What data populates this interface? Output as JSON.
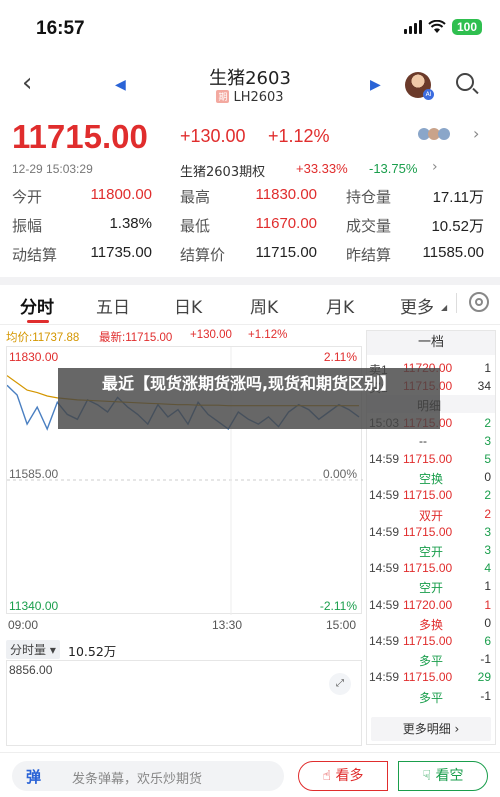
{
  "status": {
    "time": "16:57",
    "battery": "100"
  },
  "nav": {
    "title": "生猪2603",
    "tag": "期",
    "code": "LH2603"
  },
  "quote": {
    "price": "11715.00",
    "change_abs": "+130.00",
    "change_pct": "+1.12%",
    "time": "12-29 15:03:29",
    "option_name": "生猪2603期权",
    "option_up": "+33.33%",
    "option_down": "-13.75%"
  },
  "stats": [
    [
      {
        "label": "今开",
        "value": "11800.00",
        "color": "red"
      },
      {
        "label": "最高",
        "value": "11830.00",
        "color": "red"
      },
      {
        "label": "持仓量",
        "value": "17.11万",
        "color": "dark"
      }
    ],
    [
      {
        "label": "振幅",
        "value": "1.38%",
        "color": "dark"
      },
      {
        "label": "最低",
        "value": "11670.00",
        "color": "red"
      },
      {
        "label": "成交量",
        "value": "10.52万",
        "color": "dark"
      }
    ],
    [
      {
        "label": "动结算",
        "value": "11735.00",
        "color": "dark"
      },
      {
        "label": "结算价",
        "value": "11715.00",
        "color": "dark"
      },
      {
        "label": "昨结算",
        "value": "11585.00",
        "color": "dark"
      }
    ]
  ],
  "tabs": [
    "分时",
    "五日",
    "日K",
    "周K",
    "月K",
    "更多"
  ],
  "chart_header": {
    "avg": "均价:11737.88",
    "newest": "最新:11715.00",
    "abs": "+130.00",
    "pct": "+1.12%"
  },
  "chart_data": {
    "type": "line",
    "x_ticks": [
      "09:00",
      "13:30",
      "15:00"
    ],
    "y_left_ticks": [
      "11830.00",
      "11585.00",
      "11340.00"
    ],
    "y_right_ticks": [
      "2.11%",
      "0.00%",
      "-2.11%"
    ],
    "ylim": [
      11340,
      11830
    ],
    "series": [
      {
        "values": [
          11780,
          11760,
          11700,
          11735,
          11690,
          11745,
          11720,
          11710,
          11750,
          11740,
          11725,
          11755,
          11735,
          11720,
          11700,
          11740,
          11715,
          11730,
          11700,
          11745,
          11720,
          11705,
          11690,
          11725,
          11710,
          11700,
          11715,
          11695,
          11725,
          11740,
          11730,
          11710,
          11725,
          11740,
          11730,
          11715
        ]
      },
      {
        "values": [
          11800,
          11785,
          11770,
          11765,
          11758,
          11754,
          11752,
          11750,
          11749,
          11748,
          11747,
          11746,
          11745,
          11744,
          11743,
          11742,
          11741,
          11740,
          11740,
          11739,
          11739,
          11739,
          11738,
          11738,
          11738,
          11738,
          11738,
          11738,
          11738,
          11738,
          11738,
          11738,
          11738,
          11738,
          11738,
          11738
        ]
      }
    ],
    "volume_max": "8856.00",
    "volume_label": "分时量",
    "volume_total": "10.52万"
  },
  "book": {
    "header": "一档",
    "rows": [
      {
        "time": "卖1",
        "price": "11720.00",
        "qty": "1",
        "price_color": "red",
        "qty_color": "dark"
      },
      {
        "time": "买1",
        "price": "11715.00",
        "qty": "34",
        "price_color": "red",
        "qty_color": "dark"
      },
      {
        "time": "",
        "price": "明细",
        "qty": "",
        "price_color": "dark",
        "qty_color": "dark"
      },
      {
        "time": "15:03",
        "price": "11715.00",
        "qty": "2",
        "price_color": "red",
        "qty_color": "green"
      },
      {
        "time": "",
        "price": "--",
        "qty": "3",
        "price_color": "dark",
        "qty_color": "green"
      },
      {
        "time": "14:59",
        "price": "11715.00",
        "qty": "5",
        "price_color": "red",
        "qty_color": "green"
      },
      {
        "time": "",
        "price": "空换",
        "qty": "0",
        "price_color": "green",
        "qty_color": "dark"
      },
      {
        "time": "14:59",
        "price": "11715.00",
        "qty": "2",
        "price_color": "red",
        "qty_color": "green"
      },
      {
        "time": "",
        "price": "双开",
        "qty": "2",
        "price_color": "red",
        "qty_color": "red"
      },
      {
        "time": "14:59",
        "price": "11715.00",
        "qty": "3",
        "price_color": "red",
        "qty_color": "green"
      },
      {
        "time": "",
        "price": "空开",
        "qty": "3",
        "price_color": "green",
        "qty_color": "green"
      },
      {
        "time": "14:59",
        "price": "11715.00",
        "qty": "4",
        "price_color": "red",
        "qty_color": "green"
      },
      {
        "time": "",
        "price": "空开",
        "qty": "1",
        "price_color": "green",
        "qty_color": "dark"
      },
      {
        "time": "14:59",
        "price": "11720.00",
        "qty": "1",
        "price_color": "red",
        "qty_color": "red"
      },
      {
        "time": "",
        "price": "多换",
        "qty": "0",
        "price_color": "red",
        "qty_color": "dark"
      },
      {
        "time": "14:59",
        "price": "11715.00",
        "qty": "6",
        "price_color": "red",
        "qty_color": "green"
      },
      {
        "time": "",
        "price": "多平",
        "qty": "-1",
        "price_color": "green",
        "qty_color": "dark"
      },
      {
        "time": "14:59",
        "price": "11715.00",
        "qty": "29",
        "price_color": "red",
        "qty_color": "green"
      },
      {
        "time": "",
        "price": "多平",
        "qty": "-1",
        "price_color": "green",
        "qty_color": "dark"
      }
    ],
    "more_label": "更多明细 ›"
  },
  "bottom": {
    "comment_icon": "弹",
    "placeholder": "发条弹幕，欢乐炒期货",
    "bull": "看多",
    "bear": "看空"
  },
  "overlay": {
    "text": "最近【现货涨期货涨吗,现货和期货区别】"
  },
  "colors": {
    "up": "#e02d2d",
    "down": "#1a9e4c",
    "avg": "#d49600",
    "line": "#4a7fc1",
    "accent": "#2a63d6"
  }
}
